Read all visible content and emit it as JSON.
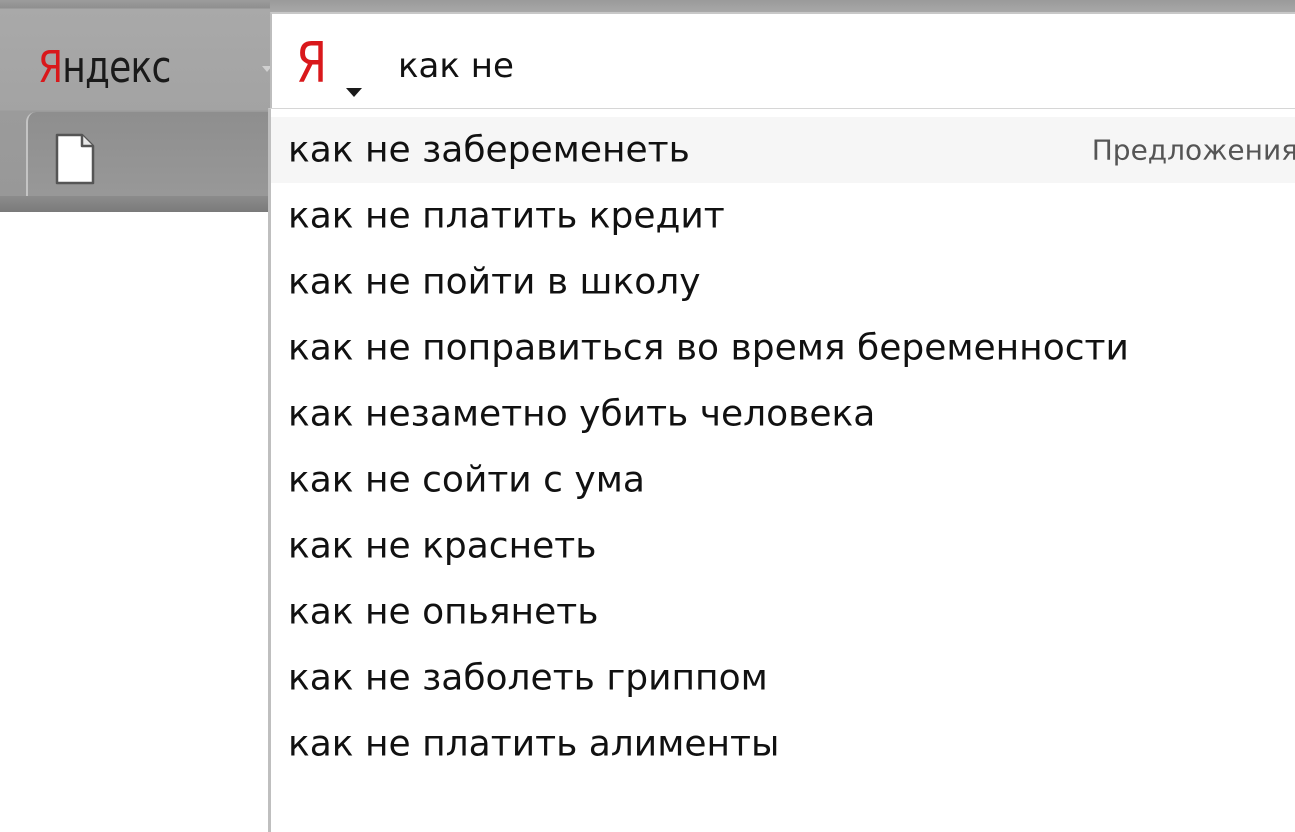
{
  "toolbar": {
    "engine_logo_first_letter": "Я",
    "engine_logo_rest": "ндекс"
  },
  "search": {
    "engine_icon": "Я",
    "query": "как не"
  },
  "suggestions": {
    "header": "Предложения",
    "items": [
      "как не забеременеть",
      "как не платить кредит",
      "как не пойти в школу",
      "как не поправиться во время беременности",
      "как незаметно убить человека",
      "как не сойти с ума",
      "как не краснеть",
      "как не опьянеть",
      "как не заболеть гриппом",
      "как не платить алименты"
    ]
  },
  "colors": {
    "brand_red": "#d9181b",
    "chrome_grey": "#a3a3a3",
    "highlight_row": "#f6f6f6"
  },
  "icons": {
    "page": "document-page-icon",
    "engine_menu": "chevron-down-icon",
    "search_engine": "yandex-ya-icon"
  }
}
